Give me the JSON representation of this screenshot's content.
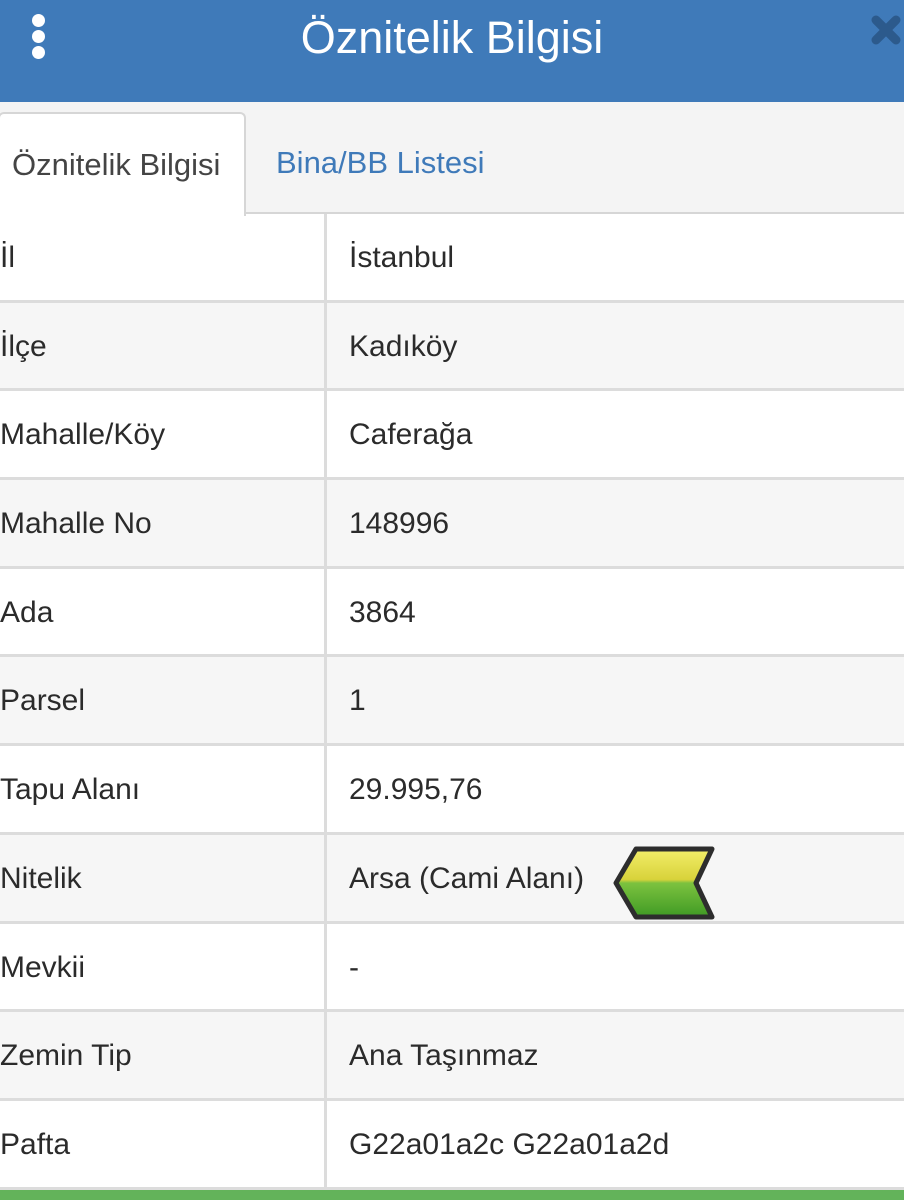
{
  "header": {
    "title": "Öznitelik Bilgisi",
    "menu_icon": "kebab-menu-icon",
    "close_icon": "close-icon",
    "color": "#3f7ab9"
  },
  "tabs": [
    {
      "label": "Öznitelik Bilgisi",
      "active": true
    },
    {
      "label": "Bina/BB Listesi",
      "active": false
    }
  ],
  "rows": [
    {
      "label": "İl",
      "value": "İstanbul"
    },
    {
      "label": "İlçe",
      "value": "Kadıköy"
    },
    {
      "label": "Mahalle/Köy",
      "value": "Caferağa"
    },
    {
      "label": "Mahalle No",
      "value": "148996"
    },
    {
      "label": "Ada",
      "value": "3864"
    },
    {
      "label": "Parsel",
      "value": "1"
    },
    {
      "label": "Tapu Alanı",
      "value": "29.995,76"
    },
    {
      "label": "Nitelik",
      "value": "Arsa (Cami Alanı)",
      "icon": "yellow-green-flag-icon"
    },
    {
      "label": "Mevkii",
      "value": "-"
    },
    {
      "label": "Zemin Tip",
      "value": "Ana Taşınmaz"
    },
    {
      "label": "Pafta",
      "value": "G22a01a2c G22a01a2d"
    }
  ],
  "colors": {
    "accent": "#3f7ab9",
    "bottom_bar": "#63b35a"
  }
}
